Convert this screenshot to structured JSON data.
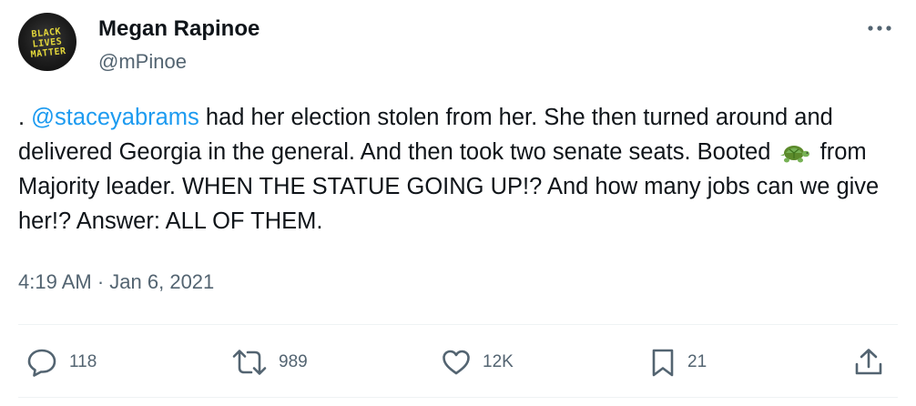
{
  "author": {
    "name": "Megan Rapinoe",
    "handle": "@mPinoe",
    "avatar_text": [
      "BLACK",
      "LIVES",
      "MATTER"
    ],
    "avatar_text_color": "#e4d83a"
  },
  "tweet": {
    "text_prefix": ". ",
    "mention": "@staceyabrams",
    "text_part1": " had her election stolen from her. She then turned around and delivered Georgia in the general. And then took two senate seats. Booted ",
    "emoji": "turtle-emoji",
    "text_part2": " from Majority leader. WHEN THE STATUE GOING UP!? And how many jobs can we give her!? Answer: ALL OF THEM.",
    "time": "4:19 AM",
    "separator": "·",
    "date": "Jan 6, 2021"
  },
  "actions": {
    "reply": {
      "icon": "reply-icon",
      "count": "118"
    },
    "retweet": {
      "icon": "retweet-icon",
      "count": "989"
    },
    "like": {
      "icon": "heart-icon",
      "count": "12K"
    },
    "bookmark": {
      "icon": "bookmark-icon",
      "count": "21"
    },
    "share": {
      "icon": "share-icon"
    }
  },
  "colors": {
    "text": "#0f1419",
    "secondary": "#536471",
    "link": "#1d9bf0",
    "divider": "#eff3f4"
  }
}
